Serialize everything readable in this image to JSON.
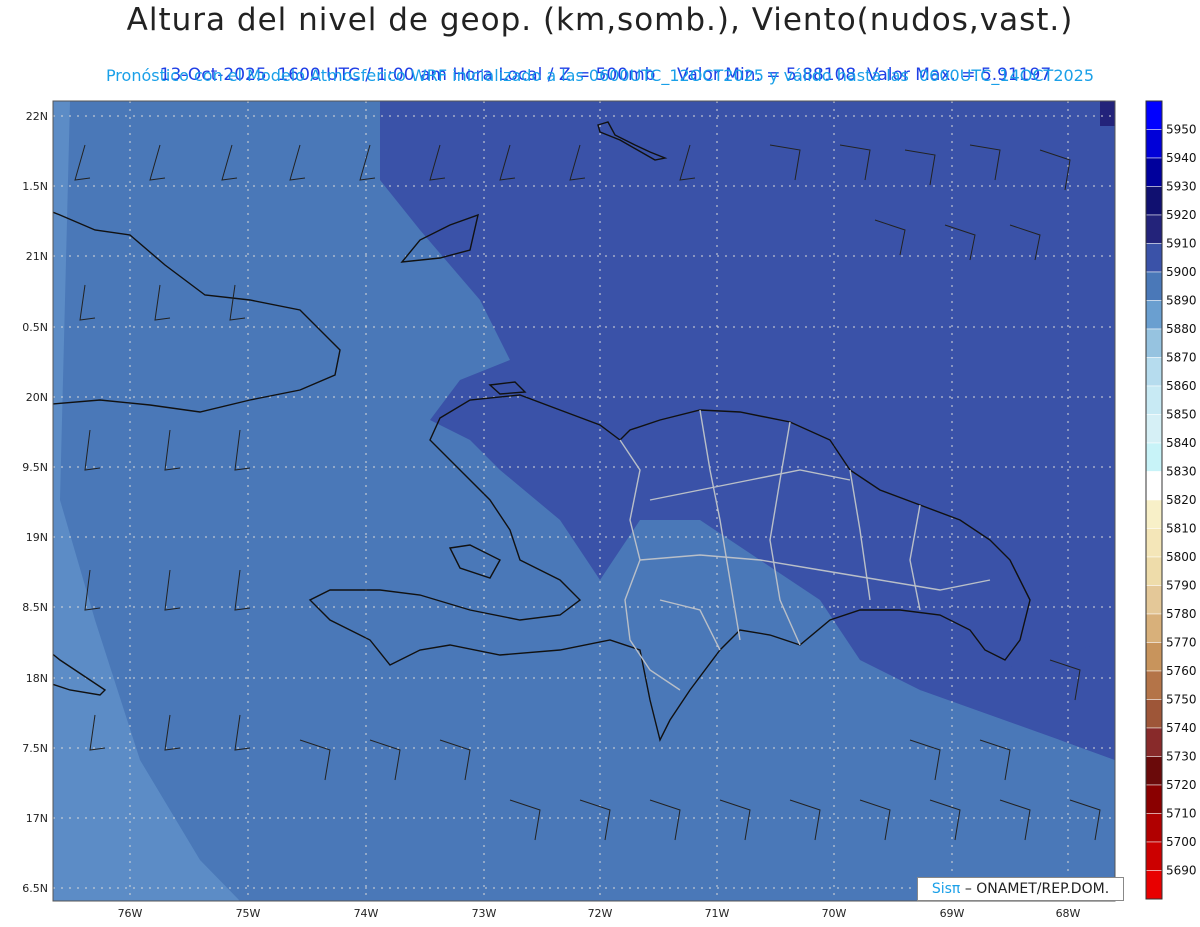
{
  "header": {
    "title": "Altura del nivel de geop. (km,somb.), Viento(nudos,vast.)",
    "date": "13-Oct-2025",
    "time": "1600 UTC / 1:00 am Hora Local / Z = 500mb",
    "min": "Valor Min. = 5.88108",
    "max": "Valor Max. = 5.91197",
    "model": "Pronóstico con el Modelo Atmosferico WRF inicializado a las 0600UTC_12OCT2025 y válido hasta las  0600UTC_14OCT2025"
  },
  "map": {
    "lat_labels": [
      "22N",
      "1.5N",
      "21N",
      "0.5N",
      "20N",
      "9.5N",
      "19N",
      "8.5N",
      "18N",
      "7.5N",
      "17N",
      "6.5N"
    ],
    "lon_labels": [
      "76W",
      "75W",
      "74W",
      "73W",
      "72W",
      "71W",
      "70W",
      "69W",
      "68W"
    ]
  },
  "colorbar": {
    "labels": [
      "5950",
      "5940",
      "5930",
      "5920",
      "5910",
      "5900",
      "5890",
      "5880",
      "5870",
      "5860",
      "5850",
      "5840",
      "5830",
      "5820",
      "5810",
      "5800",
      "5790",
      "5780",
      "5770",
      "5760",
      "5750",
      "5740",
      "5730",
      "5720",
      "5710",
      "5700",
      "5690"
    ],
    "colors": [
      "#0000ff",
      "#0000d8",
      "#00009c",
      "#101070",
      "#23237a",
      "#3a52a8",
      "#4a78b8",
      "#6a9fd0",
      "#96c3e0",
      "#b6dcee",
      "#c8eaf4",
      "#d6f0f6",
      "#c8f3f8",
      "#ffffff",
      "#f8f0c8",
      "#f4e6b8",
      "#eedcaa",
      "#e4c898",
      "#d8b07a",
      "#c8945c",
      "#b47448",
      "#9e5638",
      "#882a2a",
      "#6a0a0a",
      "#8a0000",
      "#b00000",
      "#cc0000",
      "#e80000"
    ]
  },
  "credit": {
    "sis": "Sisπ",
    "text": "– ONAMET/REP.DOM."
  }
}
